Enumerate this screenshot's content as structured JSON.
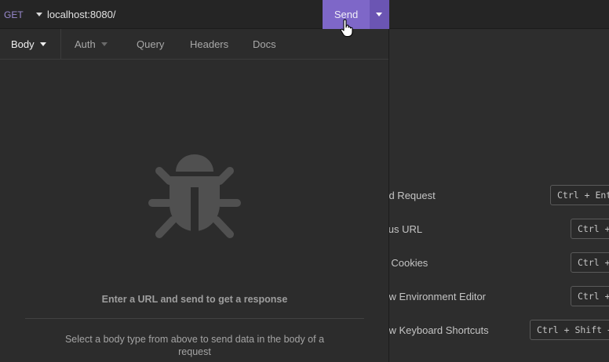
{
  "request": {
    "method": "GET",
    "url": "localhost:8080/",
    "send_label": "Send"
  },
  "tabs": [
    {
      "label": "Body",
      "active": true,
      "has_dropdown": true
    },
    {
      "label": "Auth",
      "active": false,
      "has_dropdown": true
    },
    {
      "label": "Query",
      "active": false,
      "has_dropdown": false
    },
    {
      "label": "Headers",
      "active": false,
      "has_dropdown": false
    },
    {
      "label": "Docs",
      "active": false,
      "has_dropdown": false
    }
  ],
  "empty_state": {
    "icon": "bug-icon",
    "title": "Enter a URL and send to get a response",
    "hint": "Select a body type from above to send data in the body of a request"
  },
  "shortcuts": [
    {
      "label": "end Request",
      "keys": "Ctrl + Ente"
    },
    {
      "label": "ocus URL",
      "keys": "Ctrl +"
    },
    {
      "label": "dit Cookies",
      "keys": "Ctrl +"
    },
    {
      "label": "how Environment Editor",
      "keys": "Ctrl +"
    },
    {
      "label": "how Keyboard Shortcuts",
      "keys": "Ctrl + Shift +"
    }
  ],
  "colors": {
    "accent": "#7e67c8",
    "accent_dark": "#6b55b3",
    "background": "#2d2d2d",
    "method_get": "#9a8ad0"
  }
}
